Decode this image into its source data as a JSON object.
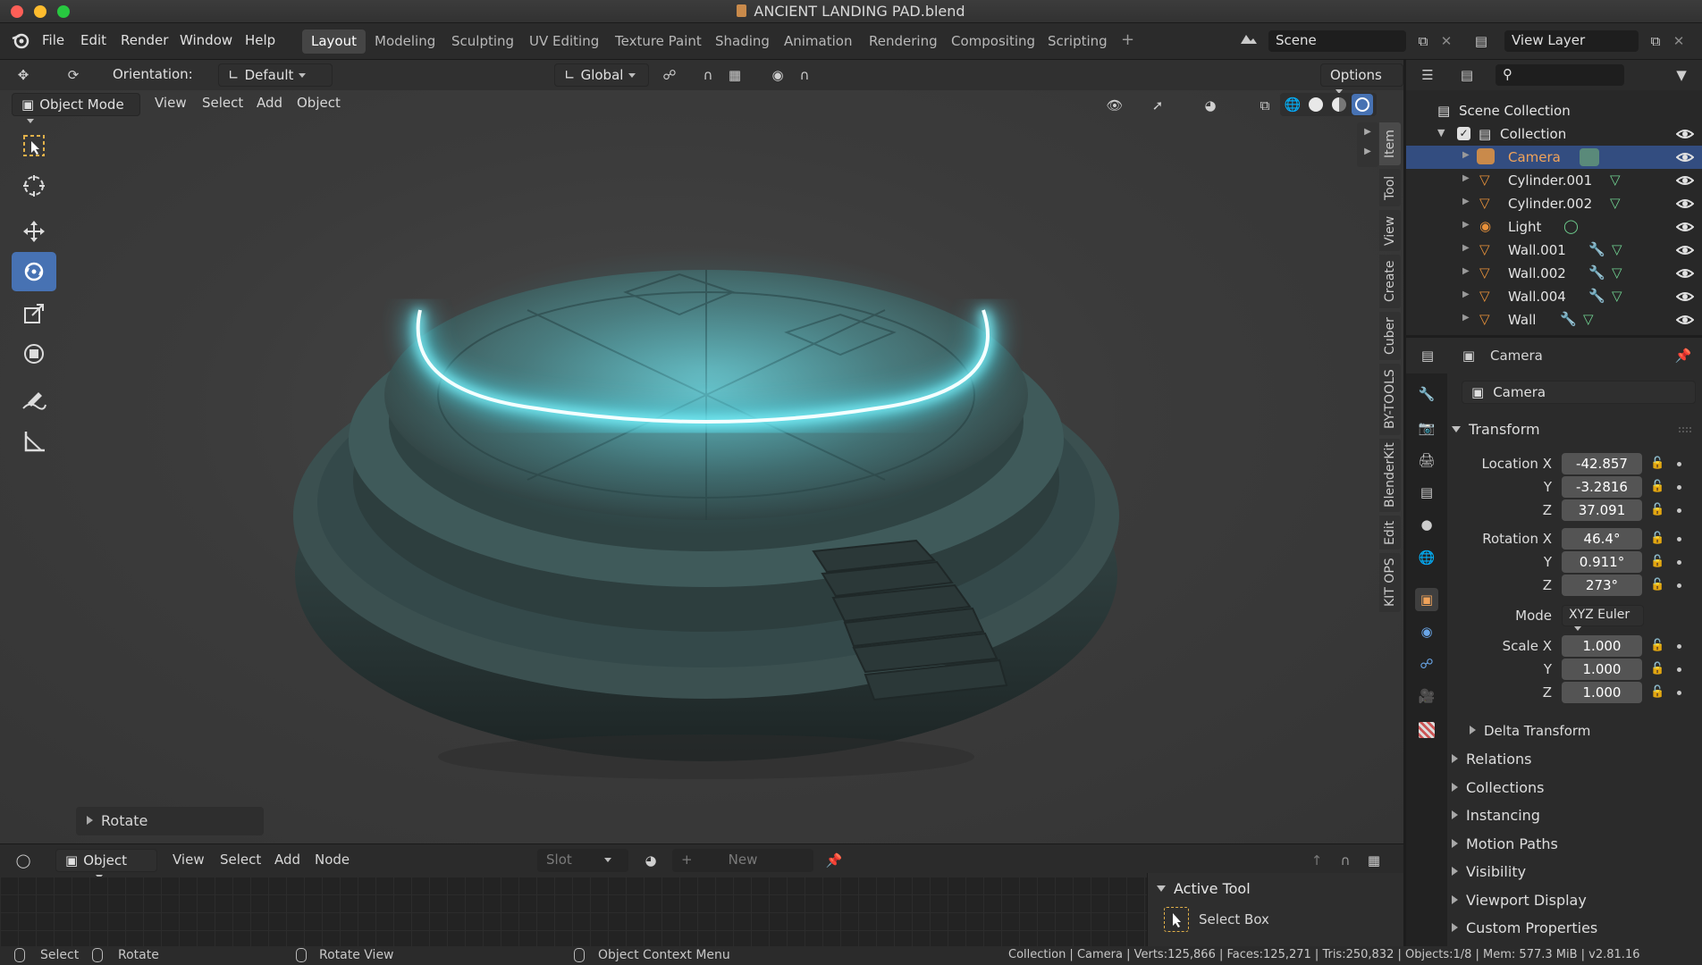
{
  "window": {
    "title": "ANCIENT LANDING PAD.blend"
  },
  "menu": [
    "File",
    "Edit",
    "Render",
    "Window",
    "Help"
  ],
  "workspaces": [
    "Layout",
    "Modeling",
    "Sculpting",
    "UV Editing",
    "Texture Paint",
    "Shading",
    "Animation",
    "Rendering",
    "Compositing",
    "Scripting"
  ],
  "active_workspace": "Layout",
  "scene": {
    "label": "Scene",
    "view_layer": "View Layer"
  },
  "tool_header": {
    "orientation_label": "Orientation:",
    "orientation_value": "Default",
    "transform_orientation": "Global",
    "options": "Options"
  },
  "viewport_header": {
    "mode": "Object Mode",
    "menus": [
      "View",
      "Select",
      "Add",
      "Object"
    ]
  },
  "side_tabs": [
    "Item",
    "Tool",
    "View",
    "Create",
    "Cuber",
    "BY-TOOLS",
    "BlenderKit",
    "Edit",
    "KIT OPS"
  ],
  "last_operator": "Rotate",
  "bottom_editor": {
    "type": "Object",
    "menus": [
      "View",
      "Select",
      "Add",
      "Node"
    ],
    "slot": "Slot",
    "new_button": "New"
  },
  "active_tool": {
    "title": "Active Tool",
    "tool": "Select Box"
  },
  "outliner": {
    "root": "Scene Collection",
    "collection": "Collection",
    "items": [
      {
        "name": "Camera",
        "selected": true
      },
      {
        "name": "Cylinder.001",
        "selected": false
      },
      {
        "name": "Cylinder.002",
        "selected": false
      },
      {
        "name": "Light",
        "selected": false
      },
      {
        "name": "Wall.001",
        "selected": false
      },
      {
        "name": "Wall.002",
        "selected": false
      },
      {
        "name": "Wall.004",
        "selected": false
      },
      {
        "name": "Wall",
        "selected": false
      }
    ]
  },
  "properties": {
    "object_name": "Camera",
    "datablock": "Camera",
    "transform_label": "Transform",
    "location_label": "Location X",
    "location": [
      "-42.857",
      "-3.2816",
      "37.091"
    ],
    "rotation_label": "Rotation X",
    "rotation": [
      "46.4°",
      "0.911°",
      "273°"
    ],
    "mode_label": "Mode",
    "mode_value": "XYZ Euler",
    "scale_label": "Scale X",
    "scale": [
      "1.000",
      "1.000",
      "1.000"
    ],
    "axis_y": "Y",
    "axis_z": "Z",
    "delta": "Delta Transform",
    "sections": [
      "Relations",
      "Collections",
      "Instancing",
      "Motion Paths",
      "Visibility",
      "Viewport Display",
      "Custom Properties"
    ]
  },
  "status": {
    "select": "Select",
    "rotate": "Rotate",
    "rotate_view": "Rotate View",
    "context_menu": "Object Context Menu",
    "stats": "Collection | Camera | Verts:125,866 | Faces:125,271 | Tris:250,832 | Objects:1/8 | Mem: 577.3 MiB | v2.81.16"
  },
  "colors": {
    "accent": "#4772b3",
    "selection": "#334d80",
    "glow": "#7ff6ff",
    "camera_label": "#f0a35a"
  }
}
